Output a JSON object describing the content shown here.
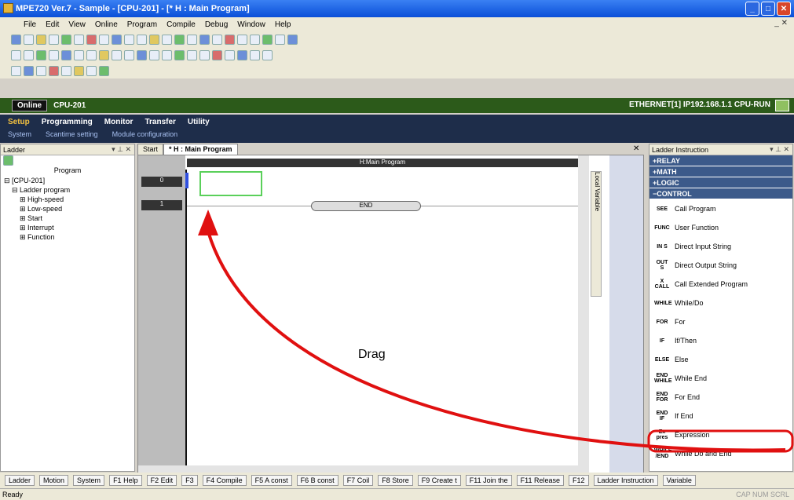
{
  "window": {
    "title": "MPE720 Ver.7 - Sample - [CPU-201] - [* H : Main Program]"
  },
  "menu": [
    "File",
    "Edit",
    "View",
    "Online",
    "Program",
    "Compile",
    "Debug",
    "Window",
    "Help"
  ],
  "online": {
    "badge": "Online",
    "cpu": "CPU-201",
    "status": "ETHERNET[1] IP192.168.1.1 CPU-RUN"
  },
  "ribbon": {
    "tabs": [
      "Setup",
      "Programming",
      "Monitor",
      "Transfer",
      "Utility"
    ],
    "subtabs": [
      "System",
      "Scantime setting",
      "Module configuration"
    ]
  },
  "left": {
    "title": "Ladder",
    "program_label": "Program",
    "tree": [
      "[CPU-201]",
      "Ladder program",
      "High-speed",
      "Low-speed",
      "Start",
      "Interrupt",
      "Function"
    ]
  },
  "editor": {
    "tabs": [
      "Start",
      "* H : Main Program"
    ],
    "header": "H:Main Program",
    "rows": [
      "0",
      "1"
    ],
    "end": "END",
    "locals": "Local Variable"
  },
  "right": {
    "title": "Ladder Instruction",
    "categories": [
      "RELAY",
      "MATH",
      "LOGIC",
      "CONTROL"
    ],
    "items": [
      {
        "sym": "SEE",
        "label": "Call Program"
      },
      {
        "sym": "FUNC",
        "label": "User Function"
      },
      {
        "sym": "IN S",
        "label": "Direct Input String"
      },
      {
        "sym": "OUT S",
        "label": "Direct Output String"
      },
      {
        "sym": "X CALL",
        "label": "Call Extended Program"
      },
      {
        "sym": "WHILE",
        "label": "While/Do"
      },
      {
        "sym": "FOR",
        "label": "For"
      },
      {
        "sym": "IF",
        "label": "If/Then"
      },
      {
        "sym": "ELSE",
        "label": "Else"
      },
      {
        "sym": "END WHILE",
        "label": "While End"
      },
      {
        "sym": "END FOR",
        "label": "For End"
      },
      {
        "sym": "END IF",
        "label": "If End"
      },
      {
        "sym": "Ex pres",
        "label": "Expression"
      },
      {
        "sym": "WHILE /END",
        "label": "While Do and End"
      }
    ]
  },
  "bottom": {
    "left_tabs": [
      "Ladder",
      "Motion",
      "System"
    ],
    "fkeys": [
      "F1 Help",
      "F2 Edit",
      "F3",
      "F4 Compile",
      "F5 A const",
      "F6 B const",
      "F7 Coil",
      "F8 Store",
      "F9 Create t",
      "F11 Join the",
      "F11 Release",
      "F12"
    ],
    "right_tabs": [
      "Ladder Instruction",
      "Variable"
    ]
  },
  "annotation": {
    "text": "Drag"
  },
  "statusbar": {
    "ready": "Ready",
    "indicators": "CAP NUM SCRL"
  }
}
